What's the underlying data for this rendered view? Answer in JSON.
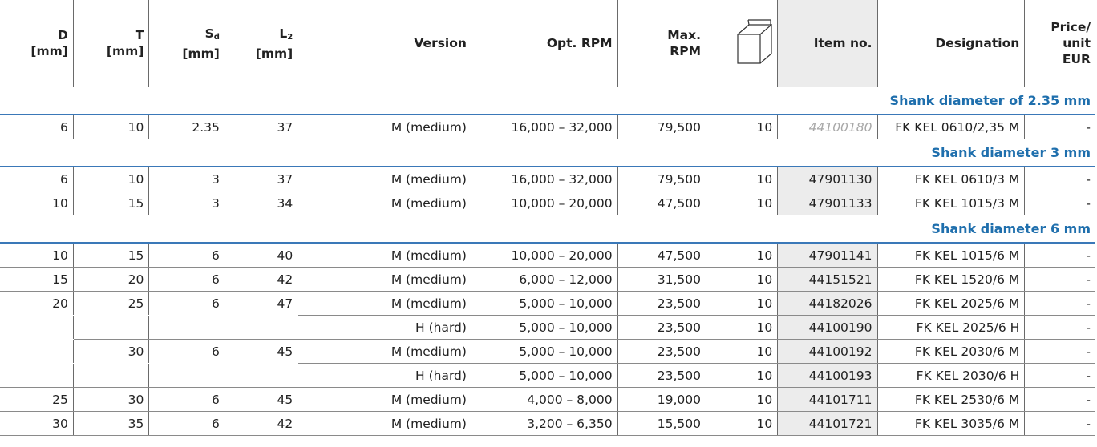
{
  "headers": {
    "d": "D",
    "d_unit": "[mm]",
    "t": "T",
    "t_unit": "[mm]",
    "sd": "S",
    "sd_sub": "d",
    "sd_unit": "[mm]",
    "l2": "L",
    "l2_sub": "2",
    "l2_unit": "[mm]",
    "version": "Version",
    "opt_rpm": "Opt. RPM",
    "max_rpm_1": "Max.",
    "max_rpm_2": "RPM",
    "pack_icon": "box-icon",
    "item_no": "Item no.",
    "designation": "Designation",
    "price_1": "Price/",
    "price_2": "unit",
    "price_3": "EUR"
  },
  "sections": [
    {
      "title": "Shank diameter of 2.35 mm"
    },
    {
      "title": "Shank diameter 3 mm"
    },
    {
      "title": "Shank diameter 6 mm"
    }
  ],
  "rows": [
    {
      "d": "6",
      "t": "10",
      "sd": "2.35",
      "l2": "37",
      "version": "M (medium)",
      "opt_rpm": "16,000 – 32,000",
      "max_rpm": "79,500",
      "pack": "10",
      "item": "44100180",
      "designation": "FK KEL 0610/2,35 M",
      "price": "-"
    },
    {
      "d": "6",
      "t": "10",
      "sd": "3",
      "l2": "37",
      "version": "M (medium)",
      "opt_rpm": "16,000 – 32,000",
      "max_rpm": "79,500",
      "pack": "10",
      "item": "47901130",
      "designation": "FK KEL 0610/3 M",
      "price": "-"
    },
    {
      "d": "10",
      "t": "15",
      "sd": "3",
      "l2": "34",
      "version": "M (medium)",
      "opt_rpm": "10,000 – 20,000",
      "max_rpm": "47,500",
      "pack": "10",
      "item": "47901133",
      "designation": "FK KEL 1015/3 M",
      "price": "-"
    },
    {
      "d": "10",
      "t": "15",
      "sd": "6",
      "l2": "40",
      "version": "M (medium)",
      "opt_rpm": "10,000 – 20,000",
      "max_rpm": "47,500",
      "pack": "10",
      "item": "47901141",
      "designation": "FK KEL 1015/6 M",
      "price": "-"
    },
    {
      "d": "15",
      "t": "20",
      "sd": "6",
      "l2": "42",
      "version": "M (medium)",
      "opt_rpm": "6,000 – 12,000",
      "max_rpm": "31,500",
      "pack": "10",
      "item": "44151521",
      "designation": "FK KEL 1520/6 M",
      "price": "-"
    },
    {
      "d": "20",
      "t": "25",
      "sd": "6",
      "l2": "47",
      "version": "M (medium)",
      "opt_rpm": "5,000 – 10,000",
      "max_rpm": "23,500",
      "pack": "10",
      "item": "44182026",
      "designation": "FK KEL 2025/6 M",
      "price": "-"
    },
    {
      "d": "",
      "t": "",
      "sd": "",
      "l2": "",
      "version": "H (hard)",
      "opt_rpm": "5,000 – 10,000",
      "max_rpm": "23,500",
      "pack": "10",
      "item": "44100190",
      "designation": "FK KEL 2025/6 H",
      "price": "-"
    },
    {
      "d": "",
      "t": "30",
      "sd": "6",
      "l2": "45",
      "version": "M (medium)",
      "opt_rpm": "5,000 – 10,000",
      "max_rpm": "23,500",
      "pack": "10",
      "item": "44100192",
      "designation": "FK KEL 2030/6 M",
      "price": "-"
    },
    {
      "d": "",
      "t": "",
      "sd": "",
      "l2": "",
      "version": "H (hard)",
      "opt_rpm": "5,000 – 10,000",
      "max_rpm": "23,500",
      "pack": "10",
      "item": "44100193",
      "designation": "FK KEL 2030/6 H",
      "price": "-"
    },
    {
      "d": "25",
      "t": "30",
      "sd": "6",
      "l2": "45",
      "version": "M (medium)",
      "opt_rpm": "4,000 – 8,000",
      "max_rpm": "19,000",
      "pack": "10",
      "item": "44101711",
      "designation": "FK KEL 2530/6 M",
      "price": "-"
    },
    {
      "d": "30",
      "t": "35",
      "sd": "6",
      "l2": "42",
      "version": "M (medium)",
      "opt_rpm": "3,200 – 6,350",
      "max_rpm": "15,500",
      "pack": "10",
      "item": "44101721",
      "designation": "FK KEL 3035/6 M",
      "price": "-"
    }
  ],
  "colors": {
    "section_title": "#1f6fad",
    "section_rule": "#3a78b8",
    "item_background": "#ececec",
    "disabled_item_text": "#a8a8a8"
  }
}
